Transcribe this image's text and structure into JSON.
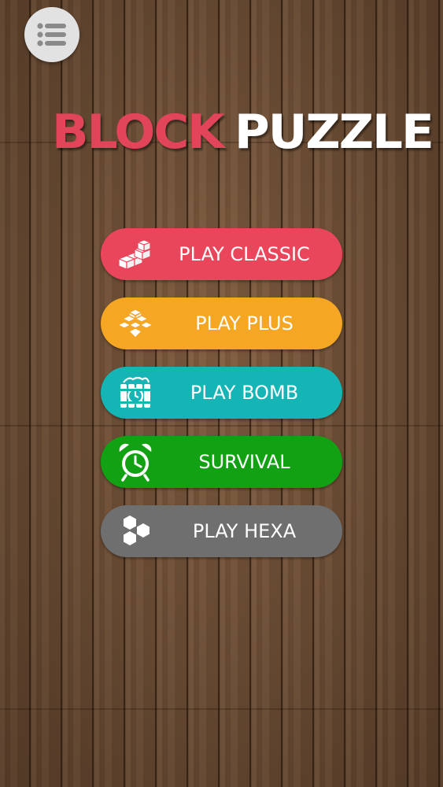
{
  "theme": {
    "title_accent": "#e2455a",
    "title_main": "#ffffff",
    "classic": "#e9465c",
    "plus": "#f5a623",
    "bomb": "#16b5b5",
    "survival": "#12a112",
    "hexa": "#6f6f6f",
    "menu_bg": "#e2e2e2",
    "menu_icon": "#8a8a8a"
  },
  "menu": {
    "icon": "list-menu-icon"
  },
  "title": {
    "part1": "BLOCK",
    "part2": "PUZZLE"
  },
  "buttons": [
    {
      "id": "classic",
      "label": "PLAY CLASSIC",
      "icon": "stair-blocks-icon"
    },
    {
      "id": "plus",
      "label": "PLAY PLUS",
      "icon": "plus-blocks-icon"
    },
    {
      "id": "bomb",
      "label": "PLAY BOMB",
      "icon": "bomb-timer-icon"
    },
    {
      "id": "survival",
      "label": "SURVIVAL",
      "icon": "alarm-clock-icon"
    },
    {
      "id": "hexa",
      "label": "PLAY HEXA",
      "icon": "hexagons-icon"
    }
  ]
}
